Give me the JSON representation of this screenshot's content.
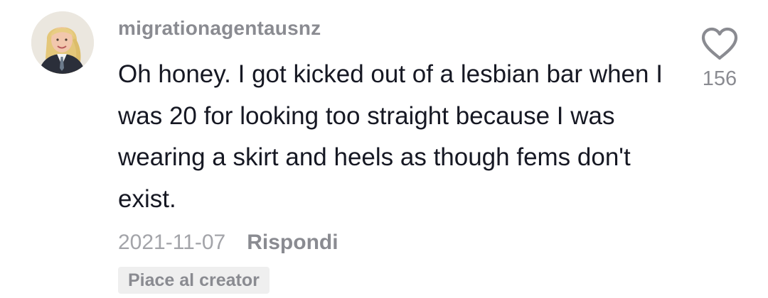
{
  "comment": {
    "username": "migrationagentausnz",
    "text": "Oh honey. I got kicked out of a lesbian bar when I was 20 for looking too straight because I was wearing a skirt and heels as though fems don't exist.",
    "date": "2021-11-07",
    "reply_label": "Rispondi",
    "creator_badge": "Piace al creator",
    "like_count": "156",
    "avatar_icon": "user-avatar",
    "like_icon": "heart-icon"
  },
  "colors": {
    "text_primary": "#161823",
    "text_secondary": "#8a8b91",
    "badge_background": "#efefef"
  }
}
